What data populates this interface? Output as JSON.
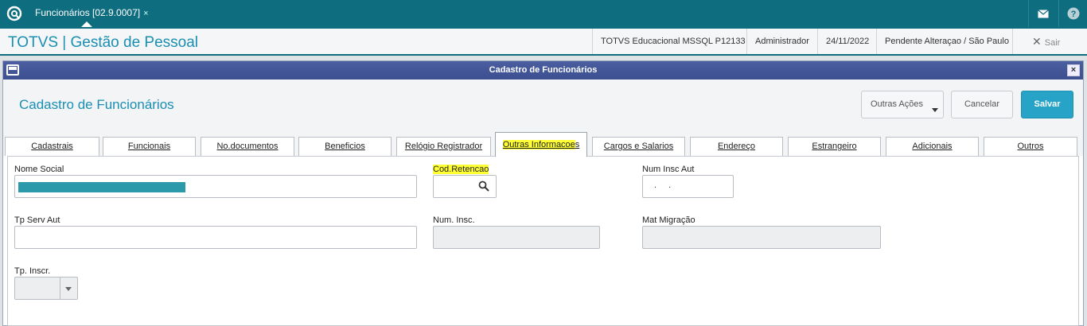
{
  "topbar": {
    "tab_label": "Funcionários [02.9.0007]",
    "tab_close": "×",
    "icons": [
      "logo-icon",
      "mail-icon",
      "help-icon"
    ]
  },
  "appbar": {
    "title": "TOTVS | Gestão de Pessoal",
    "db": "TOTVS Educacional MSSQL P12133",
    "user": "Administrador",
    "date": "24/11/2022",
    "pending": "Pendente Alteraçao / São Paulo",
    "exit": "Sair"
  },
  "window": {
    "title": "Cadastro de Funcionários",
    "close": "×"
  },
  "form": {
    "title": "Cadastro de Funcionários",
    "buttons": {
      "other_actions": "Outras Ações",
      "cancel": "Cancelar",
      "save": "Salvar"
    }
  },
  "tabs": [
    {
      "label": "Cadastrais"
    },
    {
      "label": "Funcionais"
    },
    {
      "label": "No.documentos"
    },
    {
      "label": "Beneficios"
    },
    {
      "label": "Relógio Registrador"
    },
    {
      "label_main": "Outras Informacoe",
      "label_tail": "s"
    },
    {
      "label": "Cargos e Salarios"
    },
    {
      "label": "Endereço"
    },
    {
      "label": "Estrangeiro"
    },
    {
      "label": "Adicionais"
    },
    {
      "label": "Outros"
    }
  ],
  "fields": {
    "nome_social": {
      "label": "Nome Social"
    },
    "cod_retencao": {
      "label": "Cod.Retencao"
    },
    "num_insc_aut": {
      "label": "Num Insc Aut",
      "value": ". ."
    },
    "tp_serv_aut": {
      "label": "Tp Serv Aut"
    },
    "num_insc": {
      "label": "Num. Insc."
    },
    "mat_migracao": {
      "label": "Mat Migração"
    },
    "tp_inscr": {
      "label": "Tp. Inscr."
    }
  },
  "colors": {
    "brand_teal": "#0f6d80",
    "title_blue": "#1a8fb3",
    "save_button": "#26a3c7",
    "highlight": "#ffff33"
  }
}
